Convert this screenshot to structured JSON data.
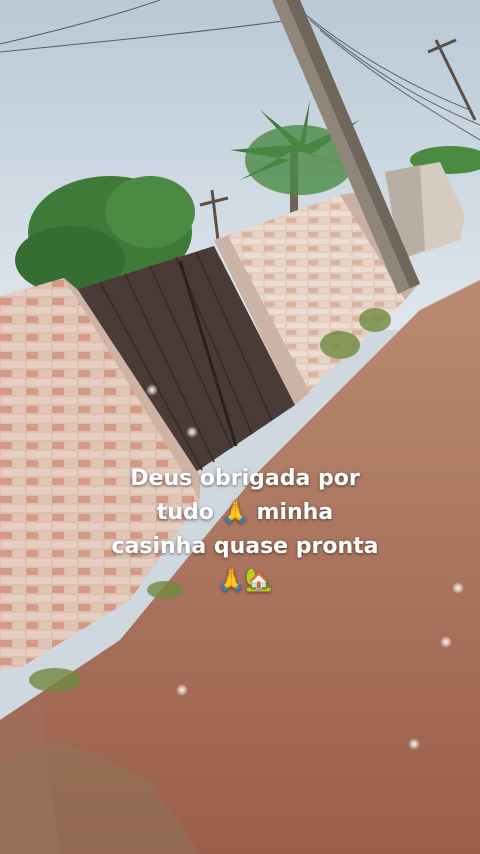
{
  "caption": {
    "line1": "Deus obrigada por",
    "line2": "tudo 🙏 minha",
    "line3": "casinha quase pronta",
    "line4": "🙏🏡"
  },
  "colors": {
    "sky": "#cdd9e3",
    "wall_brick": "#d9b3a0",
    "gate": "#4a3a35",
    "dirt": "#a86a55",
    "foliage": "#3e7a3a"
  }
}
